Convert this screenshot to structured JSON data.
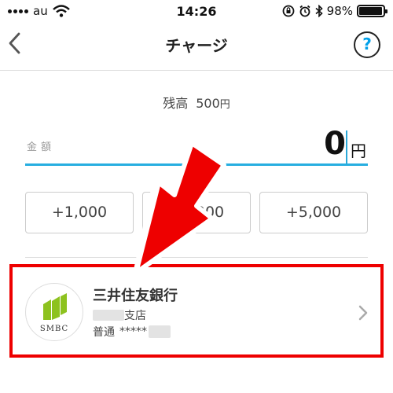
{
  "status_bar": {
    "carrier": "au",
    "time": "14:26",
    "battery_percent": "98%",
    "icons": [
      "signal-dots-icon",
      "wifi-icon",
      "orientation-lock-icon",
      "alarm-icon",
      "bluetooth-icon",
      "battery-icon"
    ]
  },
  "nav": {
    "back_icon": "chevron-left-icon",
    "title": "チャージ",
    "help_label": "?"
  },
  "balance": {
    "label": "残高",
    "amount": "500",
    "unit": "円"
  },
  "amount_field": {
    "label": "金額",
    "value": "0",
    "unit": "円"
  },
  "quick_add": [
    {
      "label": "+1,000"
    },
    {
      "label": "+3,000"
    },
    {
      "label": "+5,000"
    }
  ],
  "bank": {
    "name": "三井住友銀行",
    "logo_text": "SMBC",
    "branch_suffix": "支店",
    "account_type": "普通",
    "account_masked": "*****",
    "chevron_icon": "chevron-right-icon"
  },
  "colors": {
    "accent": "#27aee0",
    "annotation_red": "#ee0000",
    "logo_green": "#8dc21f"
  }
}
